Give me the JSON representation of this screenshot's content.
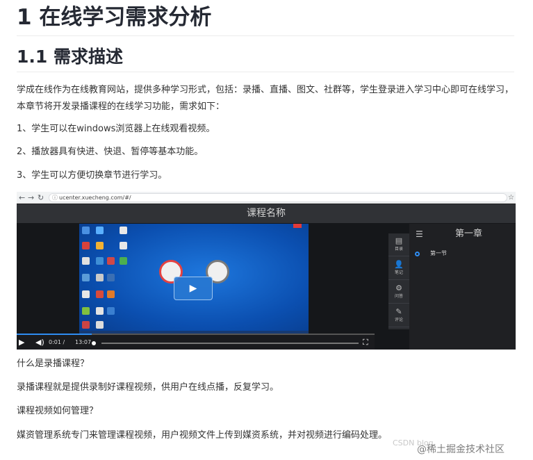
{
  "headings": {
    "h1": "1 在线学习需求分析",
    "h2": "1.1 需求描述"
  },
  "paragraphs": {
    "intro": "学成在线作为在线教育网站，提供多种学习形式，包括：录播、直播、图文、社群等，学生登录进入学习中心即可在线学习，本章节将开发录播课程的在线学习功能，需求如下：",
    "req1": "1、学生可以在windows浏览器上在线观看视频。",
    "req2": "2、播放器具有快进、快退、暂停等基本功能。",
    "req3": "3、学生可以方便切换章节进行学习。",
    "q1": "什么是录播课程？",
    "a1": "录播课程就是提供录制好课程视频，供用户在线点播，反复学习。",
    "q2": "课程视频如何管理？",
    "a2": "媒资管理系统专门来管理课程视频，用户视频文件上传到媒资系统，并对视频进行编码处理。"
  },
  "screenshot": {
    "url": "ucenter.xuecheng.com/#/",
    "player_title": "课程名称",
    "current_time": "0:01",
    "time_separator": "/",
    "duration": "13:07",
    "progress_fraction": 0.0013,
    "side_buttons": [
      {
        "icon": "catalog-icon",
        "label": "目录"
      },
      {
        "icon": "notes-icon",
        "label": "笔记"
      },
      {
        "icon": "qa-icon",
        "label": "问答"
      },
      {
        "icon": "review-icon",
        "label": "评论"
      }
    ],
    "chapter_title": "第一章",
    "section_title": "第一节"
  },
  "watermark": {
    "main": "@稀土掘金技术社区",
    "faint": "CSDN blog"
  },
  "colors": {
    "heading": "#252933",
    "body_text": "#333333",
    "player_accent": "#2f8df2",
    "video_bg": "#0b4fb0"
  }
}
